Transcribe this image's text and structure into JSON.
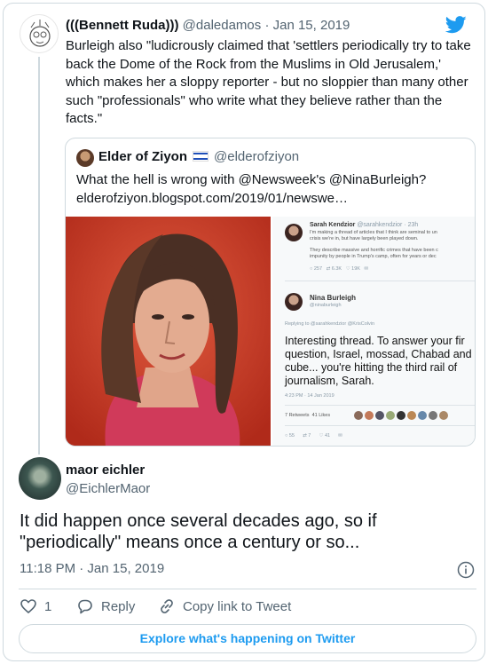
{
  "colors": {
    "accent": "#1d9bf0",
    "muted": "#536471",
    "text": "#0f1419",
    "border": "#cfd9de"
  },
  "parent": {
    "name": "(((Bennett Ruda)))",
    "handle": "@daledamos",
    "separator": "·",
    "date": "Jan 15, 2019",
    "text": "Burleigh also \"ludicrously claimed that 'settlers periodically try to take back the Dome of the Rock from the Muslims in Old Jerusalem,' which makes her a sloppy reporter - but no sloppier than many other such \"professionals\" who write what they believe rather than the facts.\"",
    "icon": "twitter-bird-icon"
  },
  "quote": {
    "name": "Elder of Ziyon",
    "handle": "@elderofziyon",
    "text_line1": "What the hell is wrong with @Newsweek's @NinaBurleigh?",
    "text_line2": "elderofziyon.blogspot.com/2019/01/newswe…",
    "screenshot": {
      "t1_name": "Sarah Kendzior",
      "t1_handle": "@sarahkendzior · 23h",
      "t1_line1": "I'm making a thread of articles that I think are seminal to un",
      "t1_line2": "crisis we're in, but have largely been played down.",
      "t1_line3": "They describe massive and horrific crimes that have been c",
      "t1_line4": "impunity by people in Trump's camp, often for years or dec",
      "t1_stats": [
        "257",
        "6.3K",
        "19K"
      ],
      "t2_name": "Nina Burleigh",
      "t2_handle": "@ninaburleigh",
      "t2_replying": "Replying to @sarahkendzior @KrisColvin",
      "t2_line1": "Interesting thread. To answer your fir",
      "t2_line2": "question, Israel, mossad, Chabad and",
      "t2_line3": "cube... you're hitting the third rail of",
      "t2_line4": "journalism, Sarah.",
      "t2_time": "4:23 PM · 14 Jan 2019",
      "t2_retweets": "7 Retweets",
      "t2_likes": "41 Likes",
      "t2_stats": [
        "55",
        "7",
        "41"
      ]
    }
  },
  "reply": {
    "name": "maor eichler",
    "handle": "@EichlerMaor",
    "text": "It did happen once several decades ago, so if \"periodically\" means once a century or so...",
    "timestamp": "11:18 PM · Jan 15, 2019",
    "like_count": "1",
    "reply_label": "Reply",
    "copy_link_label": "Copy link to Tweet"
  },
  "explore_label": "Explore what's happening on Twitter"
}
